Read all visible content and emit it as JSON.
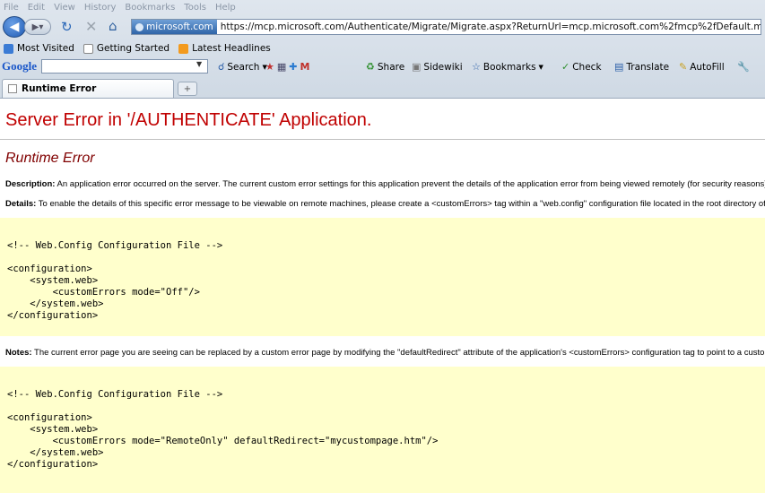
{
  "menu": [
    "File",
    "Edit",
    "View",
    "History",
    "Bookmarks",
    "Tools",
    "Help"
  ],
  "nav": {
    "site_badge": "microsoft.com",
    "url": "https://mcp.microsoft.com/Authenticate/Migrate/Migrate.aspx?ReturnUrl=mcp.microsoft.com%2fmcp%2fDefault.mspx"
  },
  "bookmarks": [
    "Most Visited",
    "Getting Started",
    "Latest Headlines"
  ],
  "toolbar": {
    "google": "Google",
    "search": "Search",
    "share": "Share",
    "sidewiki": "Sidewiki",
    "bookmarks": "Bookmarks",
    "check": "Check",
    "translate": "Translate",
    "autofill": "AutoFill"
  },
  "tab": {
    "title": "Runtime Error"
  },
  "page": {
    "server_error_title": "Server Error in '/AUTHENTICATE' Application.",
    "runtime_title": "Runtime Error",
    "description_label": "Description:",
    "description_text": " An application error occurred on the server. The current custom error settings for this application prevent the details of the application error from being viewed remotely (for security reasons). It could, howe",
    "details_label": "Details:",
    "details_text": " To enable the details of this specific error message to be viewable on remote machines, please create a <customErrors> tag within a \"web.config\" configuration file located in the root directory of the current web a",
    "code1": "\n<!-- Web.Config Configuration File -->\n\n<configuration>\n    <system.web>\n        <customErrors mode=\"Off\"/>\n    </system.web>\n</configuration>",
    "notes_label": "Notes:",
    "notes_text": " The current error page you are seeing can be replaced by a custom error page by modifying the \"defaultRedirect\" attribute of the application's <customErrors> configuration tag to point to a custom error page URL.",
    "code2": "\n<!-- Web.Config Configuration File -->\n\n<configuration>\n    <system.web>\n        <customErrors mode=\"RemoteOnly\" defaultRedirect=\"mycustompage.htm\"/>\n    </system.web>\n</configuration>"
  }
}
